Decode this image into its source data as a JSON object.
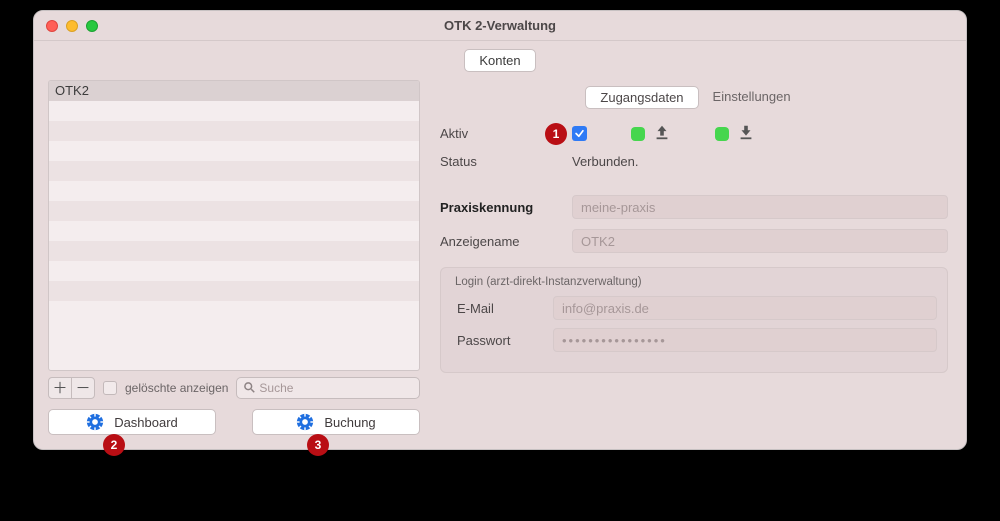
{
  "window": {
    "title": "OTK 2-Verwaltung"
  },
  "topTab": {
    "label": "Konten"
  },
  "list": {
    "items": [
      "OTK2"
    ],
    "selectedIndex": 0
  },
  "listControls": {
    "addTooltip": "Hinzufügen",
    "removeTooltip": "Entfernen",
    "showDeletedLabel": "gelöschte anzeigen",
    "showDeletedChecked": false,
    "searchPlaceholder": "Suche"
  },
  "leftButtons": {
    "dashboard": "Dashboard",
    "booking": "Buchung"
  },
  "tabs": {
    "access": "Zugangsdaten",
    "settings": "Einstellungen",
    "activeIndex": 0
  },
  "form": {
    "aktivLabel": "Aktiv",
    "aktivChecked": true,
    "statusLabel": "Status",
    "statusValue": "Verbunden.",
    "praxisLabel": "Praxiskennung",
    "praxisValue": "meine-praxis",
    "anzeigeLabel": "Anzeigename",
    "anzeigeValue": "OTK2",
    "loginLegend": "Login (arzt-direkt-Instanzverwaltung)",
    "emailLabel": "E-Mail",
    "emailValue": "info@praxis.de",
    "passLabel": "Passwort",
    "passValue": "••••••••••••••••"
  },
  "annotations": {
    "one": "1",
    "two": "2",
    "three": "3"
  }
}
